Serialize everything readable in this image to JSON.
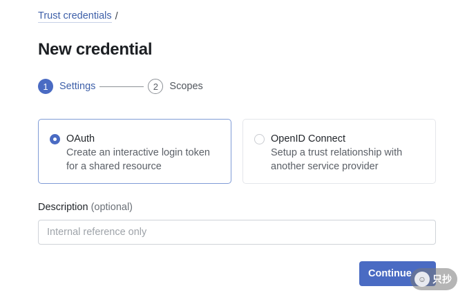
{
  "breadcrumb": {
    "link": "Trust credentials",
    "separator": "/"
  },
  "page_title": "New credential",
  "stepper": {
    "steps": [
      {
        "number": "1",
        "label": "Settings",
        "state": "active"
      },
      {
        "number": "2",
        "label": "Scopes",
        "state": "inactive"
      }
    ]
  },
  "options": [
    {
      "title": "OAuth",
      "description_line1": "Create an interactive login token",
      "description_line2": "for a shared resource",
      "selected": true
    },
    {
      "title": "OpenID Connect",
      "description_line1": "Setup a trust relationship with",
      "description_line2": "another service provider",
      "selected": false
    }
  ],
  "description_field": {
    "label": "Description",
    "optional": "(optional)",
    "placeholder": "Internal reference only",
    "value": ""
  },
  "actions": {
    "continue_label": "Continue"
  },
  "watermark": {
    "text": "只抄"
  },
  "colors": {
    "accent": "#4a6bc3",
    "link": "#3d5fa8",
    "selected_border": "#7f9bd6"
  }
}
